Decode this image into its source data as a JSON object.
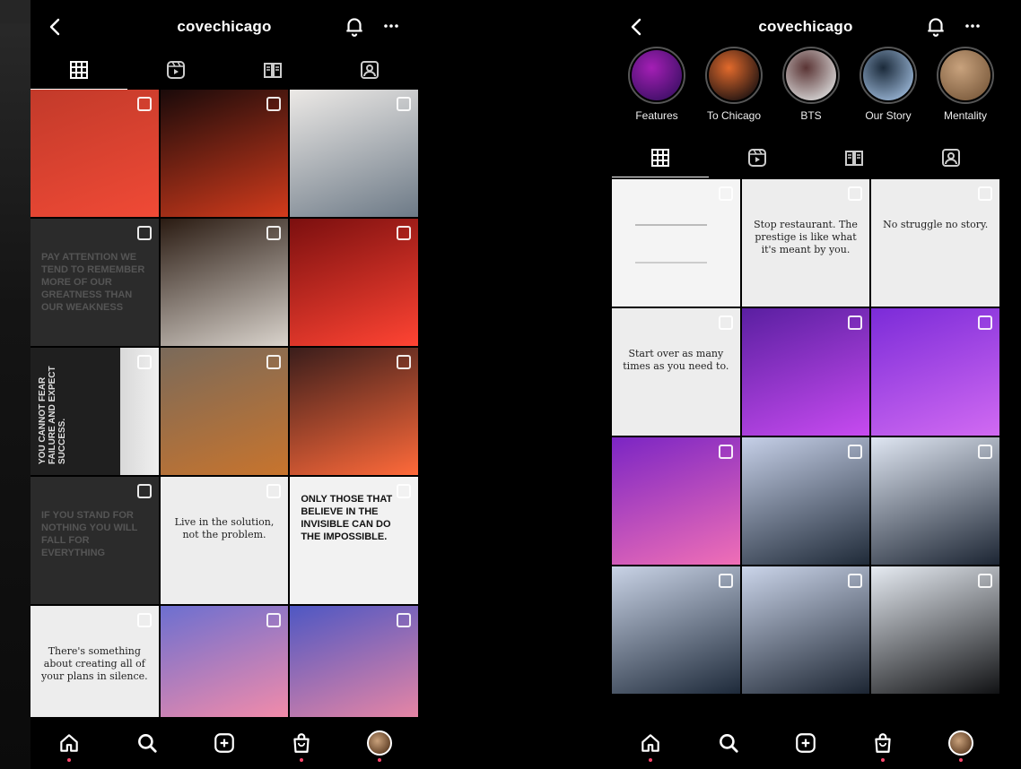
{
  "colors": {
    "background": "#000000",
    "text": "#ffffff",
    "nav_dot": "#ff4a6e"
  },
  "left": {
    "header": {
      "username": "covechicago"
    },
    "tabs": [
      {
        "icon": "grid-icon",
        "active": true
      },
      {
        "icon": "reels-icon",
        "active": false
      },
      {
        "icon": "guides-icon",
        "active": false
      },
      {
        "icon": "tagged-icon",
        "active": false
      }
    ],
    "posts": [
      {
        "kind": "photo",
        "colors": [
          "#c23a2a",
          "#f04a36"
        ]
      },
      {
        "kind": "photo",
        "colors": [
          "#1a0a0a",
          "#d23b1c"
        ]
      },
      {
        "kind": "photo",
        "colors": [
          "#ece9e6",
          "#6d7a87"
        ]
      },
      {
        "kind": "text-dark",
        "text": "Pay attention we tend to remember more of our greatness than our weakness"
      },
      {
        "kind": "photo",
        "colors": [
          "#2a1b12",
          "#d9d3cc"
        ]
      },
      {
        "kind": "photo",
        "colors": [
          "#7b0f0f",
          "#ff4433"
        ]
      },
      {
        "kind": "vertical",
        "text": "You cannot fear failure and expect success."
      },
      {
        "kind": "photo",
        "colors": [
          "#7a6a5a",
          "#c8742d"
        ]
      },
      {
        "kind": "photo",
        "colors": [
          "#3a1d1b",
          "#ff6a3a"
        ]
      },
      {
        "kind": "text-dark",
        "text": "If you stand for nothing you will fall for everything"
      },
      {
        "kind": "hand",
        "text": "Live in the solution, not the problem."
      },
      {
        "kind": "statement",
        "text": "Only those that believe in the invisible can do the impossible."
      },
      {
        "kind": "hand",
        "text": "There's something about creating all of your plans in silence."
      },
      {
        "kind": "photo",
        "colors": [
          "#6c6fd0",
          "#ff8ea6"
        ]
      },
      {
        "kind": "photo",
        "colors": [
          "#4e57c3",
          "#f58aa2"
        ]
      }
    ]
  },
  "right": {
    "header": {
      "username": "covechicago"
    },
    "highlights": [
      {
        "label": "Features",
        "colors": [
          "#a41fb5",
          "#3b0f64"
        ]
      },
      {
        "label": "To Chicago",
        "colors": [
          "#e26a2c",
          "#1a1111"
        ]
      },
      {
        "label": "BTS",
        "colors": [
          "#5a3434",
          "#dcdcdc"
        ]
      },
      {
        "label": "Our Story",
        "colors": [
          "#1b2a3a",
          "#9cb8d8"
        ]
      },
      {
        "label": "Mentality",
        "colors": [
          "#c8a27d",
          "#7a5a3c"
        ]
      }
    ],
    "tabs": [
      {
        "icon": "grid-icon",
        "active": true
      },
      {
        "icon": "reels-icon",
        "active": false
      },
      {
        "icon": "guides-icon",
        "active": false
      },
      {
        "icon": "tagged-icon",
        "active": false
      }
    ],
    "posts": [
      {
        "kind": "light-note"
      },
      {
        "kind": "hand",
        "text": "Stop restaurant. The prestige is like what it's meant by you."
      },
      {
        "kind": "hand",
        "text": "No struggle no story."
      },
      {
        "kind": "hand",
        "text": "Start over as many times as you need to."
      },
      {
        "kind": "photo",
        "colors": [
          "#5a1fa1",
          "#c74bf0"
        ]
      },
      {
        "kind": "photo",
        "colors": [
          "#7b2bd8",
          "#d16af2"
        ]
      },
      {
        "kind": "photo",
        "colors": [
          "#7b25c4",
          "#f06fb6"
        ]
      },
      {
        "kind": "photo",
        "colors": [
          "#c6d0e8",
          "#1f2a38"
        ]
      },
      {
        "kind": "photo",
        "colors": [
          "#dfe6f2",
          "#1c2533"
        ]
      },
      {
        "kind": "photo",
        "colors": [
          "#c9d3e6",
          "#1e2a3a"
        ]
      },
      {
        "kind": "photo",
        "colors": [
          "#cbd5ea",
          "#1c2532"
        ]
      },
      {
        "kind": "photo",
        "colors": [
          "#e6ebf2",
          "#111214"
        ]
      }
    ]
  },
  "bottom_nav": [
    {
      "icon": "home-icon",
      "active": true
    },
    {
      "icon": "search-icon",
      "active": false
    },
    {
      "icon": "new-post-icon",
      "active": false
    },
    {
      "icon": "shop-icon",
      "active": false
    },
    {
      "icon": "profile-avatar",
      "active": false
    }
  ]
}
